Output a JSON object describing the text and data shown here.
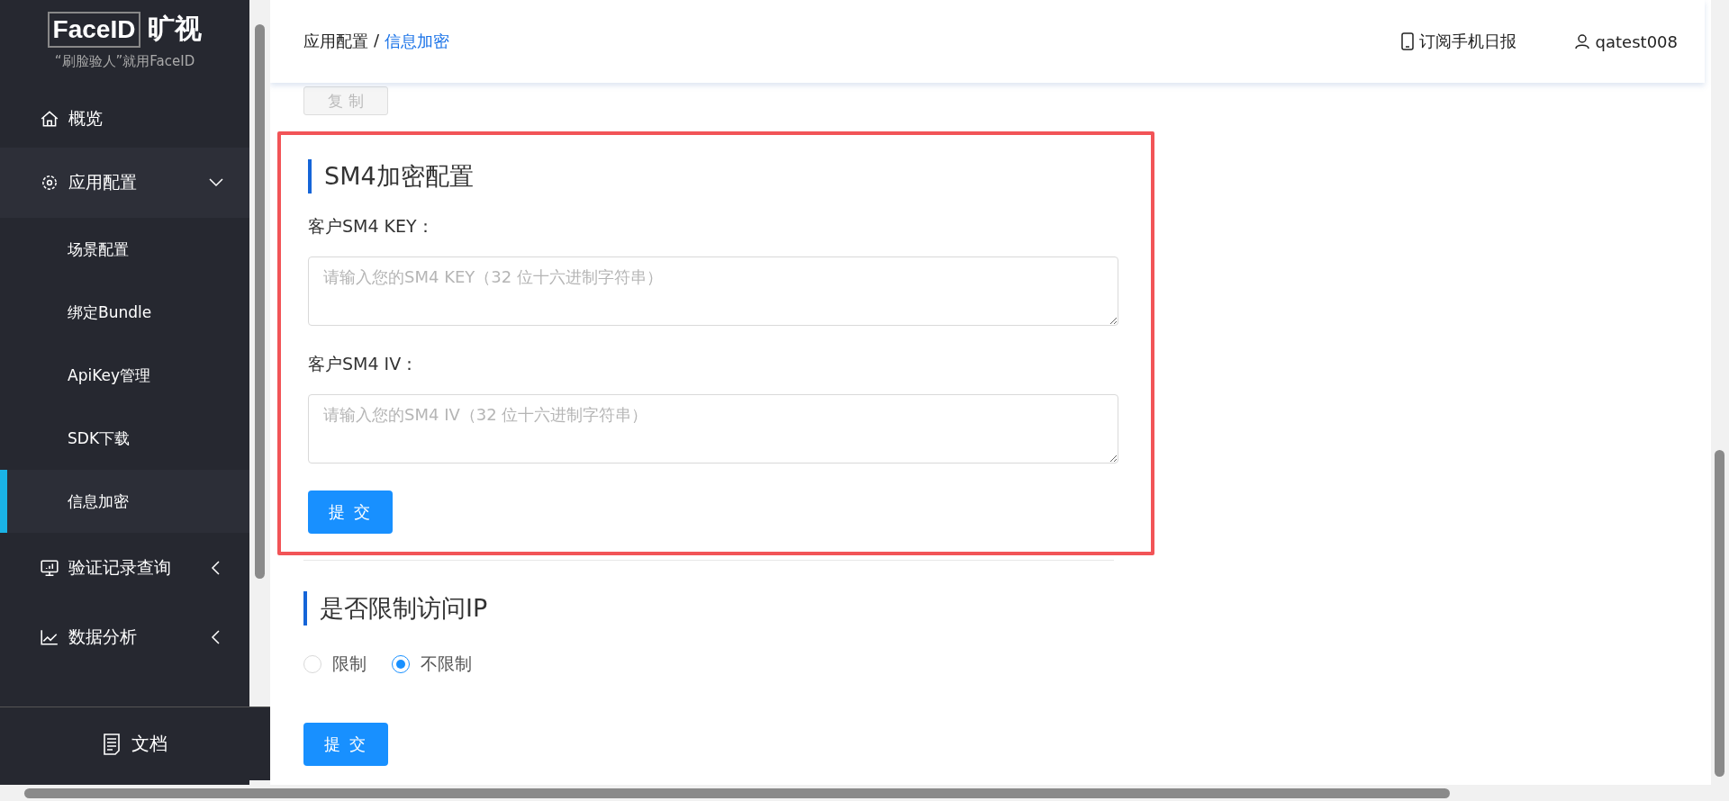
{
  "logo": {
    "brand": "FaceID",
    "brand_cn": "旷视",
    "tagline": "“刷脸验人”就用FaceID"
  },
  "sidebar": {
    "items": [
      {
        "label": "概览",
        "kind": "home"
      },
      {
        "label": "应用配置",
        "kind": "gear",
        "expanded": true,
        "children": [
          {
            "label": "场景配置",
            "selected": false
          },
          {
            "label": "绑定Bundle",
            "selected": false
          },
          {
            "label": "ApiKey管理",
            "selected": false
          },
          {
            "label": "SDK下载",
            "selected": false
          },
          {
            "label": "信息加密",
            "selected": true
          }
        ]
      },
      {
        "label": "验证记录查询",
        "kind": "monitor",
        "expanded": false
      },
      {
        "label": "数据分析",
        "kind": "chart",
        "expanded": false
      }
    ],
    "doc": "文档"
  },
  "header": {
    "breadcrumb": [
      "应用配置",
      "信息加密"
    ],
    "separator": "/",
    "subscribe": "订阅手机日报",
    "user": "qatest008"
  },
  "copy_button": {
    "label": "复 制",
    "disabled": true
  },
  "sm4": {
    "highlighted": true,
    "title": "SM4加密配置",
    "fields": [
      {
        "label": "客户SM4 KEY：",
        "placeholder": "请输入您的SM4 KEY（32 位十六进制字符串）"
      },
      {
        "label": "客户SM4 IV：",
        "placeholder": "请输入您的SM4 IV（32 位十六进制字符串）"
      }
    ],
    "submit": "提 交"
  },
  "ip_section": {
    "title": "是否限制访问IP",
    "options": [
      {
        "label": "限制",
        "selected": false
      },
      {
        "label": "不限制",
        "selected": true
      }
    ],
    "submit": "提 交"
  }
}
